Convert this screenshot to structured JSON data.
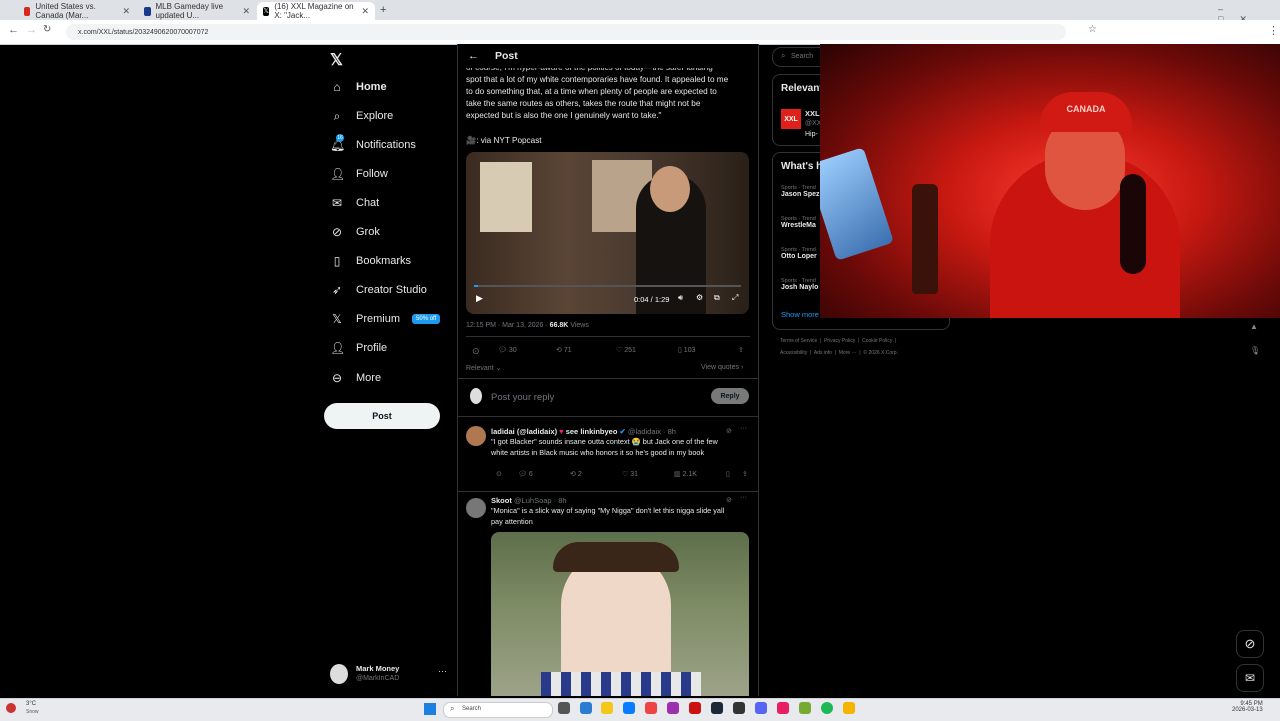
{
  "browser": {
    "tabs": [
      {
        "title": "United States vs. Canada (Mar..."
      },
      {
        "title": "MLB Gameday live updated U..."
      },
      {
        "title": "(16) XXL Magazine on X: \"Jack..."
      }
    ],
    "url": "x.com/XXL/status/2032490620070007072"
  },
  "sidebar": {
    "items": [
      {
        "label": "Home"
      },
      {
        "label": "Explore"
      },
      {
        "label": "Notifications"
      },
      {
        "label": "Follow"
      },
      {
        "label": "Chat"
      },
      {
        "label": "Grok"
      },
      {
        "label": "Bookmarks"
      },
      {
        "label": "Creator Studio"
      },
      {
        "label": "Premium",
        "badge": "50% off"
      },
      {
        "label": "Profile"
      },
      {
        "label": "More"
      }
    ],
    "post_button": "Post",
    "account": {
      "name": "Mark Money",
      "handle": "@MarkInCAD"
    }
  },
  "post": {
    "header_title": "Post",
    "text_lines": [
      "of course, I'm hyper-aware of the politics of today—the safer landing",
      "spot that a lot of my white contemporaries have found. It appealed to me",
      "to do something that, at a time when plenty of people are expected to",
      "take the same routes as others, takes the route that might not be",
      "expected but is also the one I genuinely want to take.\""
    ],
    "credit": "🎥: via NYT Popcast",
    "video_time": "0:04 / 1:29",
    "meta_time": "12:15 PM · Mar 13, 2026 ·",
    "views": "66.8K",
    "views_label": "Views",
    "stats": {
      "replies": "30",
      "reposts": "71",
      "likes": "251",
      "bookmarks": "103"
    },
    "sort_label": "Relevant",
    "view_quotes": "View quotes",
    "reply_placeholder": "Post your reply",
    "reply_button": "Reply"
  },
  "replies": [
    {
      "name": "ladidai (@ladidaix)",
      "name2": "see linkinbyeo",
      "handle": "@ladidaix · 8h",
      "text_lines": [
        "\"I got Blacker\" sounds insane outta context 😭 but Jack one of the few",
        "white artists in Black music who honors it so he's good in my book"
      ],
      "stats": {
        "replies": "6",
        "reposts": "2",
        "likes": "31",
        "views": "2.1K"
      }
    },
    {
      "name": "Skoot",
      "handle": "@LuhSoap · 8h",
      "text_lines": [
        "\"Monica\" is a slick way of saying \"My Nigga\" don't let this nigga slide yall",
        "pay attention"
      ]
    }
  ],
  "right": {
    "search_placeholder": "Search",
    "relevant_title": "Relevant",
    "relevant_name": "XXL",
    "relevant_handle": "@XX",
    "relevant_bio": "Hip-",
    "happening_title": "What's h",
    "trends": [
      {
        "context": "Sports · Trend",
        "name": "Jason Spez"
      },
      {
        "context": "Sports · Trend",
        "name": "WrestleMa"
      },
      {
        "context": "Sports · Trend",
        "name": "Otto Loper"
      },
      {
        "context": "Sports · Trend",
        "name": "Josh Naylo"
      }
    ],
    "show_more": "Show more",
    "footer_line1": [
      "Terms of Service",
      "Privacy Policy",
      "Cookie Policy"
    ],
    "footer_line2": [
      "Accessibility",
      "Ads info",
      "More ···",
      "© 2026 X Corp."
    ]
  },
  "taskbar": {
    "weather_temp": "3°C",
    "weather_desc": "Snow",
    "search_label": "Search",
    "clock_time": "9:45 PM",
    "clock_date": "2026-03-13"
  },
  "colors": {
    "accent": "#1d9bf0",
    "bg": "#000000",
    "border": "#2f3336"
  }
}
